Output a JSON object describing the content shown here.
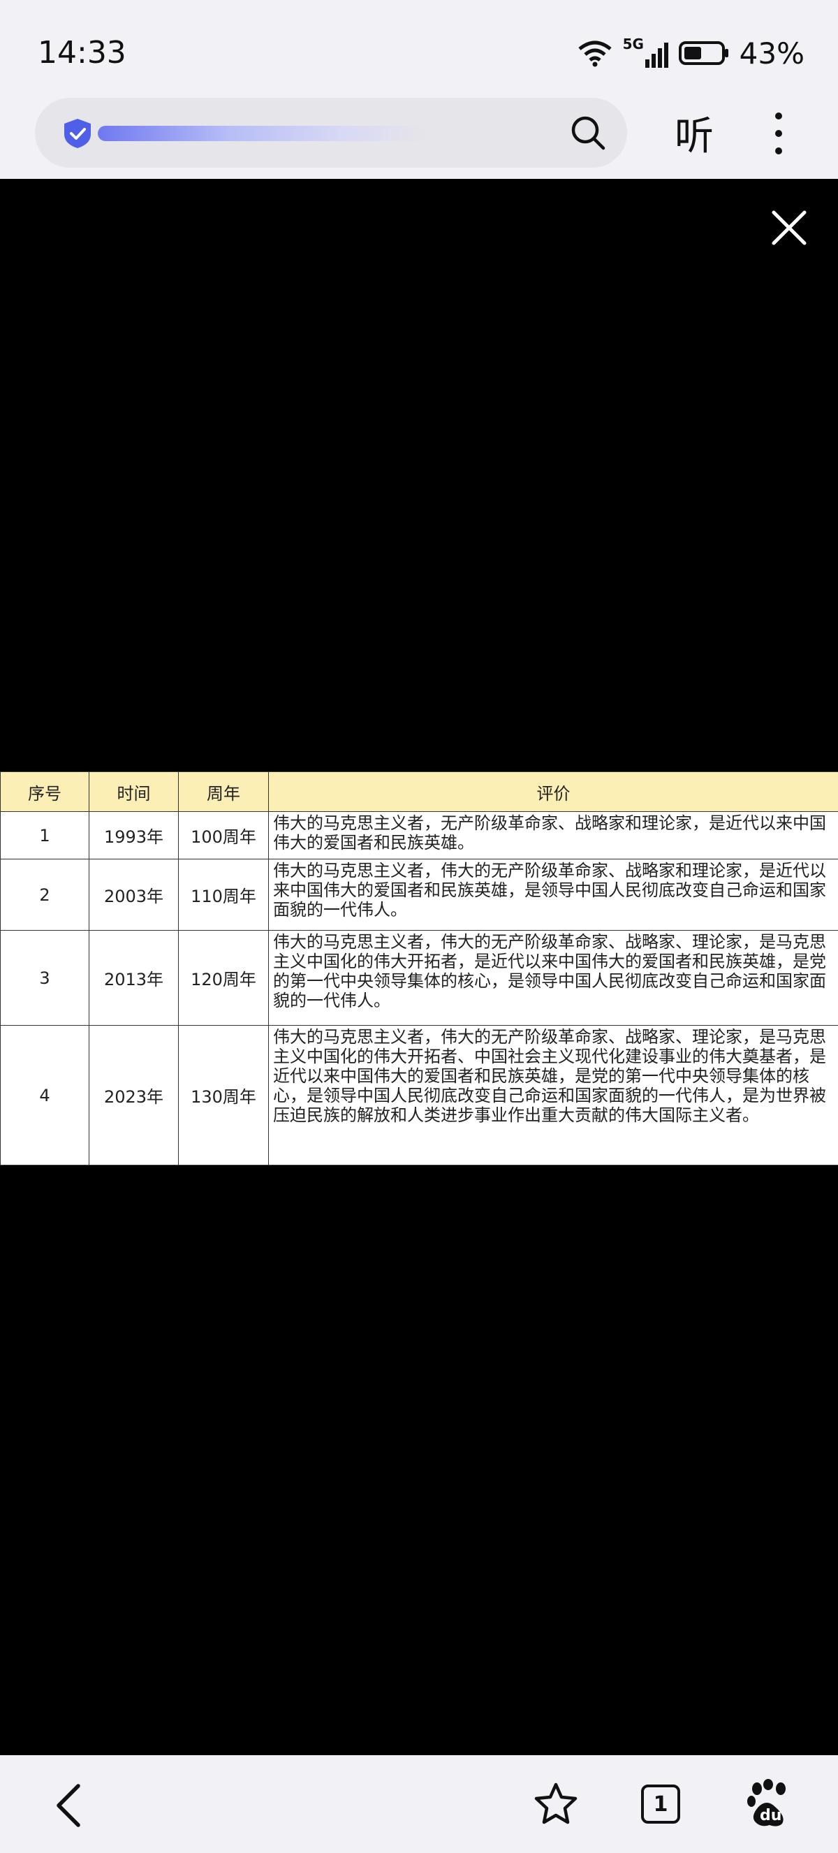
{
  "status_bar": {
    "time": "14:33",
    "network": "5G",
    "battery": "43%"
  },
  "toolbar": {
    "listen_label": "听"
  },
  "viewer": {
    "table": {
      "headers": [
        "序号",
        "时间",
        "周年",
        "评价"
      ],
      "rows": [
        {
          "no": "1",
          "year": "1993年",
          "anniversary": "100周年",
          "evaluation": "伟大的马克思主义者，无产阶级革命家、战略家和理论家，是近代以来中国伟大的爱国者和民族英雄。"
        },
        {
          "no": "2",
          "year": "2003年",
          "anniversary": "110周年",
          "evaluation": "伟大的马克思主义者，伟大的无产阶级革命家、战略家和理论家，是近代以来中国伟大的爱国者和民族英雄，是领导中国人民彻底改变自己命运和国家面貌的一代伟人。"
        },
        {
          "no": "3",
          "year": "2013年",
          "anniversary": "120周年",
          "evaluation": "伟大的马克思主义者，伟大的无产阶级革命家、战略家、理论家，是马克思主义中国化的伟大开拓者，是近代以来中国伟大的爱国者和民族英雄，是党的第一代中央领导集体的核心，是领导中国人民彻底改变自己命运和国家面貌的一代伟人。"
        },
        {
          "no": "4",
          "year": "2023年",
          "anniversary": "130周年",
          "evaluation": "伟大的马克思主义者，伟大的无产阶级革命家、战略家、理论家，是马克思主义中国化的伟大开拓者、中国社会主义现代化建设事业的伟大奠基者，是近代以来中国伟大的爱国者和民族英雄，是党的第一代中央领导集体的核心，是领导中国人民彻底改变自己命运和国家面貌的一代伟人，是为世界被压迫民族的解放和人类进步事业作出重大贡献的伟大国际主义者。"
        }
      ]
    }
  },
  "bottom_nav": {
    "tabs_count": "1",
    "baidu_text": "du"
  },
  "colors": {
    "bar_bg": "#f2f1f6",
    "header_bg": "#fcefb5",
    "accent": "#4f5fe8"
  },
  "icons": [
    "wifi-icon",
    "signal-icon",
    "battery-icon",
    "shield-icon",
    "search-icon",
    "more-icon",
    "close-icon",
    "back-icon",
    "star-icon",
    "tabs-icon",
    "baidu-paw-icon"
  ]
}
